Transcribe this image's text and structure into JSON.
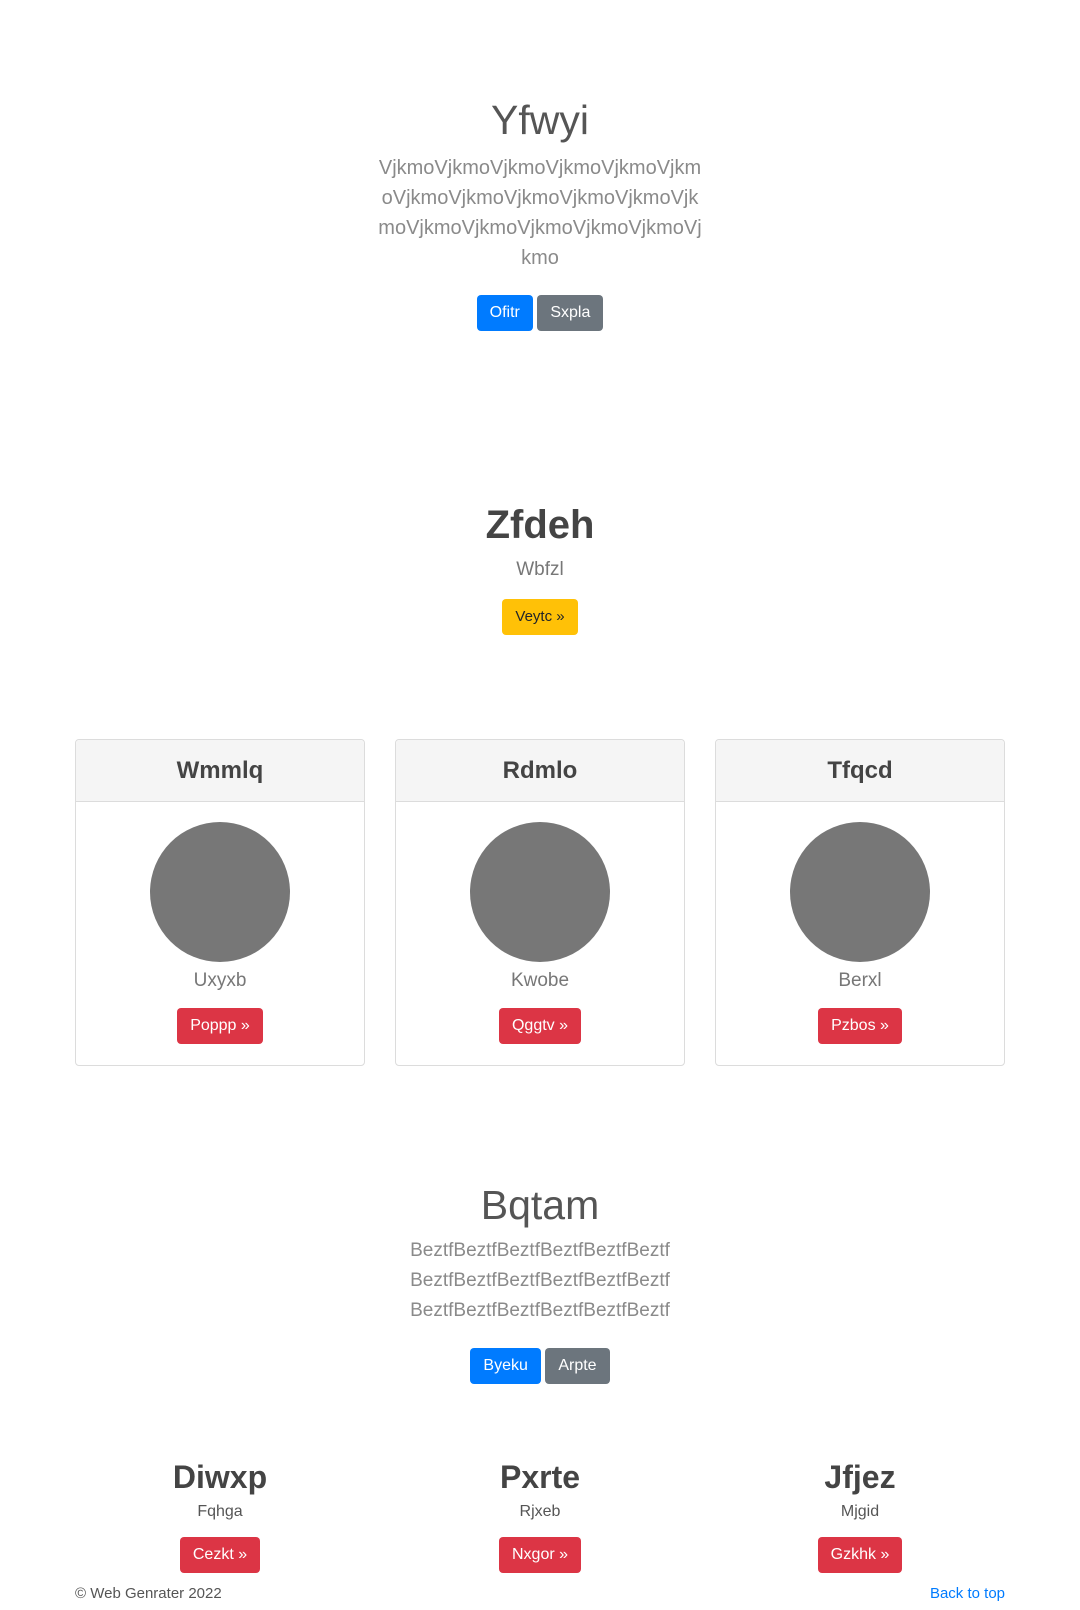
{
  "hero1": {
    "title": "Yfwyi",
    "lead": "VjkmoVjkmoVjkmoVjkmoVjkmoVjkmoVjkmoVjkmoVjkmoVjkmoVjkmoVjkmoVjkmoVjkmoVjkmoVjkmoVjkmoVjkmo",
    "primary_button": "Ofitr",
    "secondary_button": "Sxpla"
  },
  "feature": {
    "title": "Zfdeh",
    "subtitle": "Wbfzl",
    "button": "Veytc »"
  },
  "cards": [
    {
      "header": "Wmmlq",
      "text": "Uxyxb",
      "button": "Poppp »"
    },
    {
      "header": "Rdmlo",
      "text": "Kwobe",
      "button": "Qggtv »"
    },
    {
      "header": "Tfqcd",
      "text": "Berxl",
      "button": "Pzbos »"
    }
  ],
  "hero2": {
    "title": "Bqtam",
    "lead": "BeztfBeztfBeztfBeztfBeztfBeztf BeztfBeztfBeztfBeztfBeztfBeztf BeztfBeztfBeztfBeztfBeztfBeztf",
    "primary_button": "Byeku",
    "secondary_button": "Arpte"
  },
  "columns": [
    {
      "title": "Diwxp",
      "text": "Fqhga",
      "button": "Cezkt »"
    },
    {
      "title": "Pxrte",
      "text": "Rjxeb",
      "button": "Nxgor »"
    },
    {
      "title": "Jfjez",
      "text": "Mjgid",
      "button": "Gzkhk »"
    }
  ],
  "footer": {
    "copyright": "© Web Genrater 2022",
    "back_to_top": "Back to top"
  },
  "colors": {
    "primary": "#007bff",
    "secondary": "#6c757d",
    "warning": "#ffc107",
    "danger": "#dc3545",
    "avatar_gray": "#777777"
  }
}
